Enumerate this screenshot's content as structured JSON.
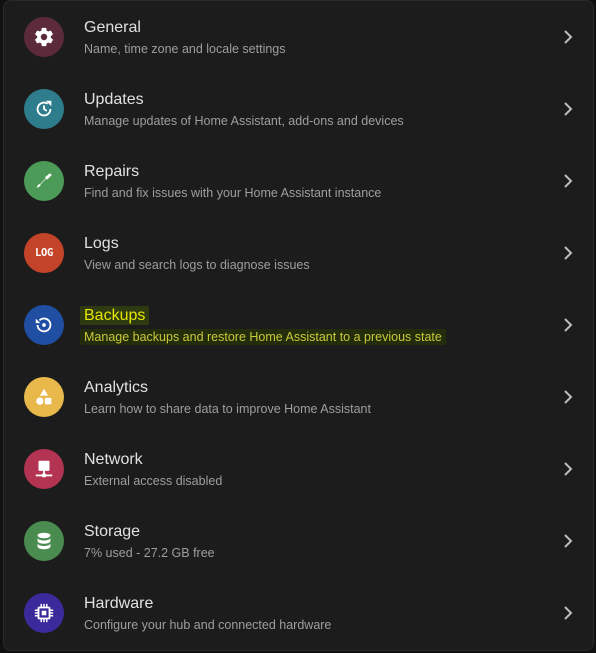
{
  "items": [
    {
      "title": "General",
      "subtitle": "Name, time zone and locale settings",
      "icon": "gear-icon",
      "color": "#5c2a3b"
    },
    {
      "title": "Updates",
      "subtitle": "Manage updates of Home Assistant, add-ons and devices",
      "icon": "update-icon",
      "color": "#2e7d8c"
    },
    {
      "title": "Repairs",
      "subtitle": "Find and fix issues with your Home Assistant instance",
      "icon": "screwdriver-icon",
      "color": "#4b9a57"
    },
    {
      "title": "Logs",
      "subtitle": "View and search logs to diagnose issues",
      "icon": "log-icon",
      "icon_text": "LOG",
      "color": "#c4442a"
    },
    {
      "title": "Backups",
      "subtitle": "Manage backups and restore Home Assistant to a previous state",
      "icon": "backup-restore-icon",
      "color": "#1f4ea3",
      "highlighted": true
    },
    {
      "title": "Analytics",
      "subtitle": "Learn how to share data to improve Home Assistant",
      "icon": "shapes-icon",
      "color": "#e8b94a"
    },
    {
      "title": "Network",
      "subtitle": "External access disabled",
      "icon": "network-icon",
      "color": "#b23352"
    },
    {
      "title": "Storage",
      "subtitle": "7% used - 27.2 GB free",
      "icon": "database-icon",
      "color": "#4a8c4f"
    },
    {
      "title": "Hardware",
      "subtitle": "Configure your hub and connected hardware",
      "icon": "chip-icon",
      "color": "#3a2a9c"
    }
  ],
  "colors": {
    "background": "#1c1c1c",
    "title": "#e1e1e1",
    "subtitle": "#9e9e9e",
    "chevron": "#bdbdbd",
    "highlight_text": "#e6e600",
    "highlight_bg": "#2f3a10"
  }
}
